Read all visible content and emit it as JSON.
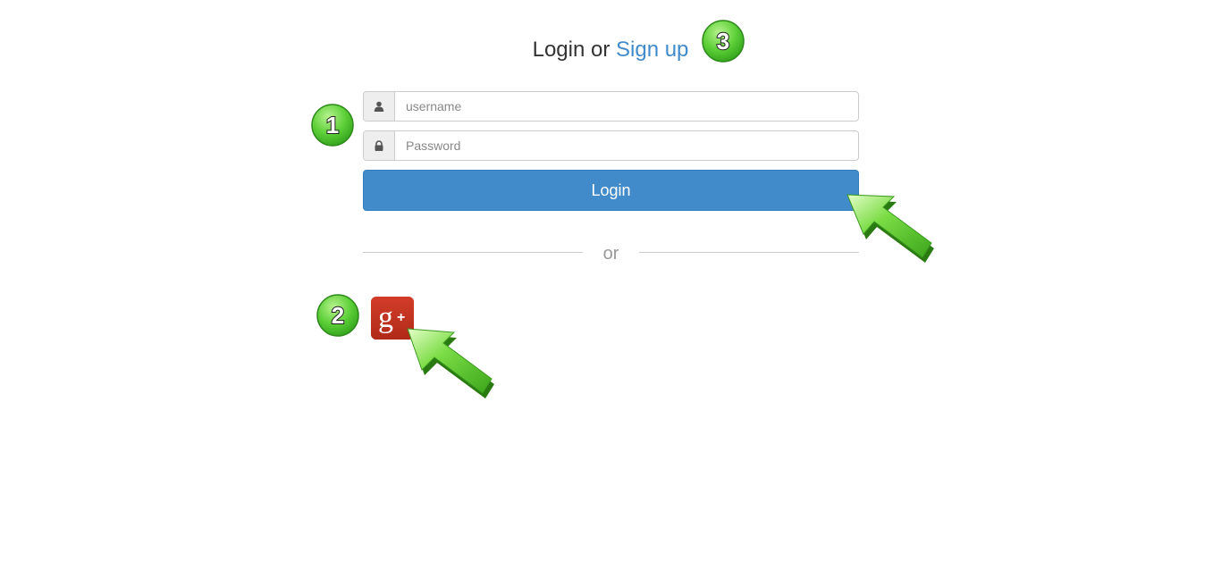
{
  "header": {
    "login_text": "Login or",
    "signup_link": "Sign up"
  },
  "form": {
    "username": {
      "value": "",
      "placeholder": "username",
      "icon": "user-icon"
    },
    "password": {
      "value": "",
      "placeholder": "Password",
      "icon": "lock-icon"
    },
    "login_button": "Login"
  },
  "separator": {
    "text": "or"
  },
  "social": {
    "google_plus_label": "g+",
    "icon": "google-plus-icon",
    "color": "#c1311f"
  },
  "annotations": {
    "badges": [
      "1",
      "2",
      "3"
    ],
    "badge_color": "#3cb521",
    "arrow_color": "#5cc827"
  },
  "colors": {
    "accent": "#428bca",
    "muted": "#999999"
  }
}
